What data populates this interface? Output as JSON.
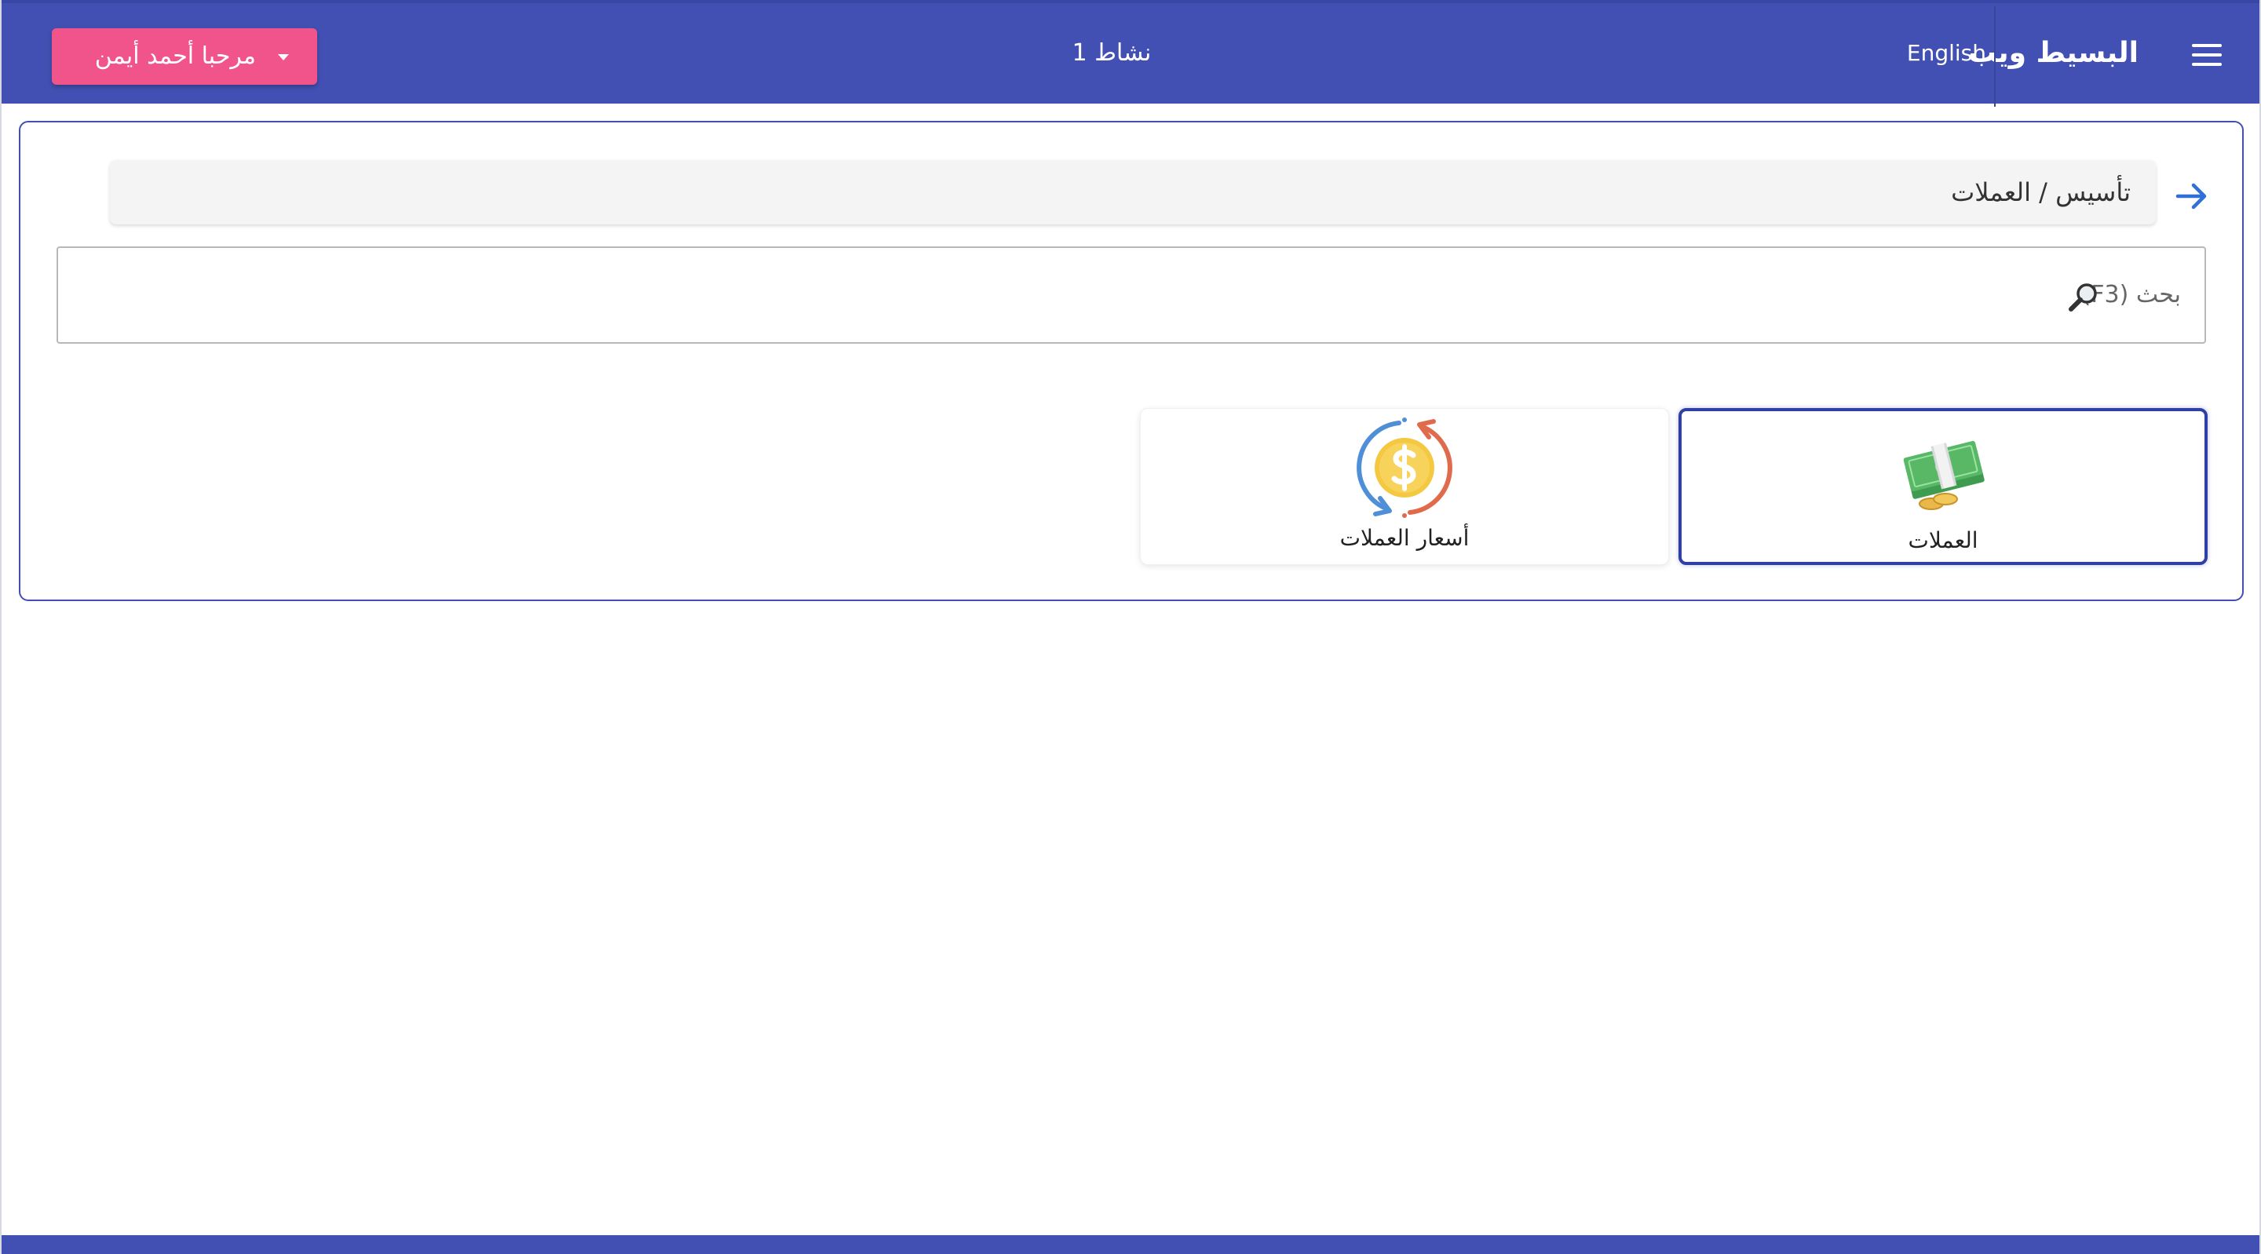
{
  "header": {
    "brand": "البسيط ويب",
    "language_link": "English",
    "activity": "نشاط 1",
    "user_menu_label": "مرحبا أحمد أيمن",
    "background_color": "#4350b3",
    "user_button_color": "#f0548a"
  },
  "breadcrumb": {
    "path": "تأسيس / العملات",
    "back_icon": "arrow-right-icon"
  },
  "search": {
    "placeholder": "بحث (F3)",
    "value": "",
    "icon": "magnifier-icon"
  },
  "tiles": [
    {
      "label": "العملات",
      "icon": "money-stack-icon",
      "selected": true
    },
    {
      "label": "أسعار العملات",
      "icon": "currency-exchange-icon",
      "selected": false
    }
  ]
}
